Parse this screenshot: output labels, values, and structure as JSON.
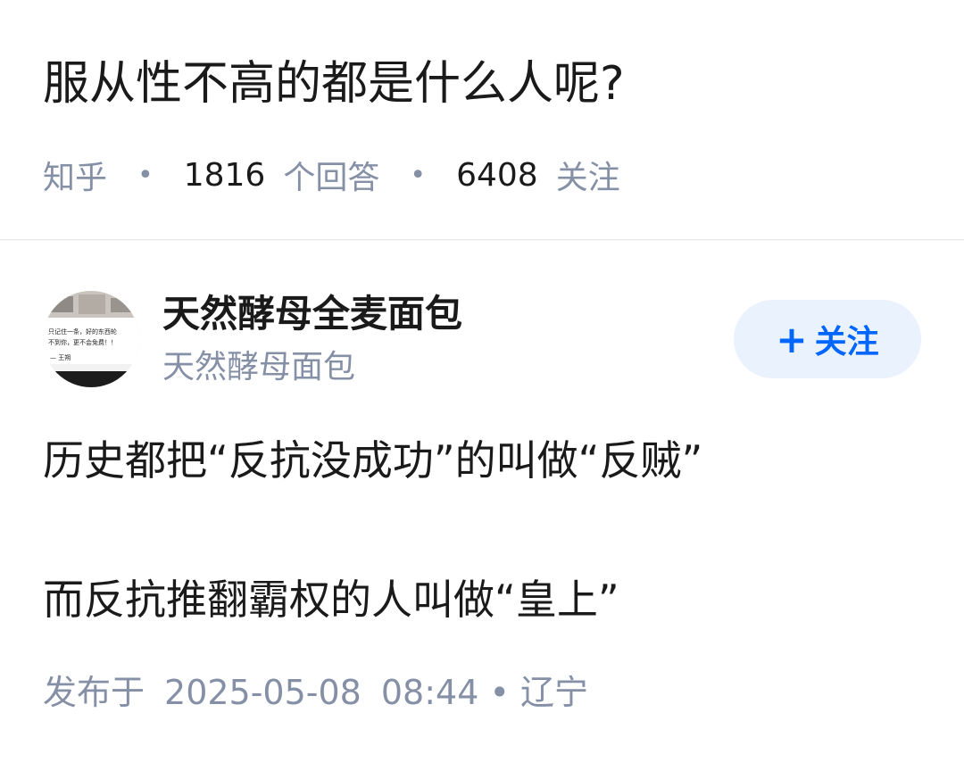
{
  "question": {
    "title": "服从性不高的都是什么人呢?",
    "source": "知乎",
    "answer_count": "1816",
    "answer_label": "个回答",
    "follower_count": "6408",
    "follower_label": "关注",
    "separator": "•"
  },
  "answer": {
    "author": {
      "name": "天然酵母全麦面包",
      "bio": "天然酵母面包",
      "avatar_text": [
        "只记住一条，好的东西轮",
        "不到你，更不会免费！！",
        "— 王朔"
      ]
    },
    "follow_button": {
      "icon": "plus-icon",
      "plus": "+",
      "label": "关注"
    },
    "paragraphs": [
      "历史都把“反抗没成功”的叫做“反贼”",
      "而反抗推翻霸权的人叫做“皇上”"
    ],
    "meta": {
      "published_label": "发布于",
      "date": "2025-05-08",
      "time": "08:44",
      "separator": "•",
      "location": "辽宁"
    }
  },
  "colors": {
    "primary_text": "#1a1a1a",
    "secondary_text": "#8590a6",
    "accent": "#0066ff",
    "follow_bg": "#eaf2fd"
  }
}
